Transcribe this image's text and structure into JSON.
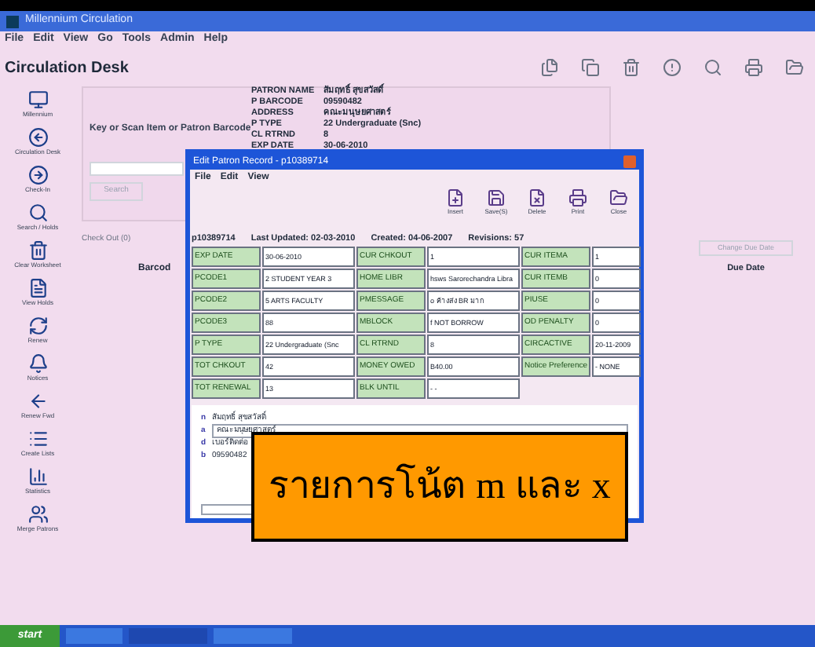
{
  "window": {
    "title": "Millennium Circulation"
  },
  "menu": [
    "File",
    "Edit",
    "View",
    "Go",
    "Tools",
    "Admin",
    "Help"
  ],
  "header": "Circulation Desk",
  "sidebar": [
    "Millennium",
    "Circulation Desk",
    "Check-In",
    "Search / Holds",
    "Clear Worksheet",
    "View Holds",
    "Renew",
    "Notices",
    "Renew Fwd",
    "Create Lists",
    "Statistics",
    "Merge Patrons"
  ],
  "barcode_prompt": "Key or Scan Item or Patron Barcode",
  "search_button": {
    "label": "Search",
    "disabled": true
  },
  "patron": [
    {
      "label": "PATRON NAME",
      "value": "สัมฤทธิ์ สุขสวัสดิ์"
    },
    {
      "label": "P BARCODE",
      "value": "09590482"
    },
    {
      "label": "ADDRESS",
      "value": "คณะมนุษยศาสตร์"
    },
    {
      "label": "P TYPE",
      "value": "22 Undergraduate (Snc)"
    },
    {
      "label": "CL RTRND",
      "value": "8"
    },
    {
      "label": "EXP DATE",
      "value": "30-06-2010"
    }
  ],
  "checkout_tab": "Check Out (0)",
  "columns": [
    "Barcod",
    "Due Date"
  ],
  "change_due_button": {
    "label": "Change Due Date",
    "disabled": true
  },
  "dialog": {
    "title": "Edit Patron Record - p10389714",
    "menu": [
      "File",
      "Edit",
      "View"
    ],
    "toolbar": [
      "Insert",
      "Save(S)",
      "Delete",
      "Print",
      "Close"
    ],
    "info": [
      "p10389714",
      "Last Updated: 02-03-2010",
      "Created: 04-06-2007",
      "Revisions: 57"
    ],
    "fixed_fields": [
      [
        {
          "label": "EXP DATE",
          "value": "30-06-2010"
        },
        {
          "label": "PCODE1",
          "value": "2  STUDENT YEAR 3"
        },
        {
          "label": "PCODE2",
          "value": "5  ARTS FACULTY"
        },
        {
          "label": "PCODE3",
          "value": "88"
        },
        {
          "label": "P TYPE",
          "value": "22  Undergraduate (Snc"
        },
        {
          "label": "TOT CHKOUT",
          "value": "42"
        },
        {
          "label": "TOT RENEWAL",
          "value": "13"
        }
      ],
      [
        {
          "label": "CUR CHKOUT",
          "value": "1"
        },
        {
          "label": "HOME LIBR",
          "value": "hsws  Sarorechandra Libra"
        },
        {
          "label": "PMESSAGE",
          "value": "o  ค้างส่ง BR มาก"
        },
        {
          "label": "MBLOCK",
          "value": "f  NOT BORROW"
        },
        {
          "label": "CL RTRND",
          "value": "8"
        },
        {
          "label": "MONEY OWED",
          "value": "B40.00"
        },
        {
          "label": "BLK UNTIL",
          "value": "- -"
        }
      ],
      [
        {
          "label": "CUR ITEMA",
          "value": "1"
        },
        {
          "label": "CUR ITEMB",
          "value": "0"
        },
        {
          "label": "PIUSE",
          "value": "0"
        },
        {
          "label": "OD PENALTY",
          "value": "0"
        },
        {
          "label": "CIRCACTIVE",
          "value": "20-11-2009"
        },
        {
          "label": "Notice Preference",
          "value": "-  NONE"
        }
      ]
    ],
    "variable_fields": [
      {
        "tag": "n",
        "value": "สัมฤทธิ์ สุขสวัสดิ์",
        "editing": false
      },
      {
        "tag": "a",
        "value": "คณะมนุษยศาสตร์",
        "editing": true
      },
      {
        "tag": "d",
        "value": "เบอร์ติดต่อ",
        "editing": false
      },
      {
        "tag": "b",
        "value": "09590482",
        "editing": false
      }
    ]
  },
  "callout": "รายการโน้ต m และ x",
  "taskbar": {
    "start": "start"
  }
}
